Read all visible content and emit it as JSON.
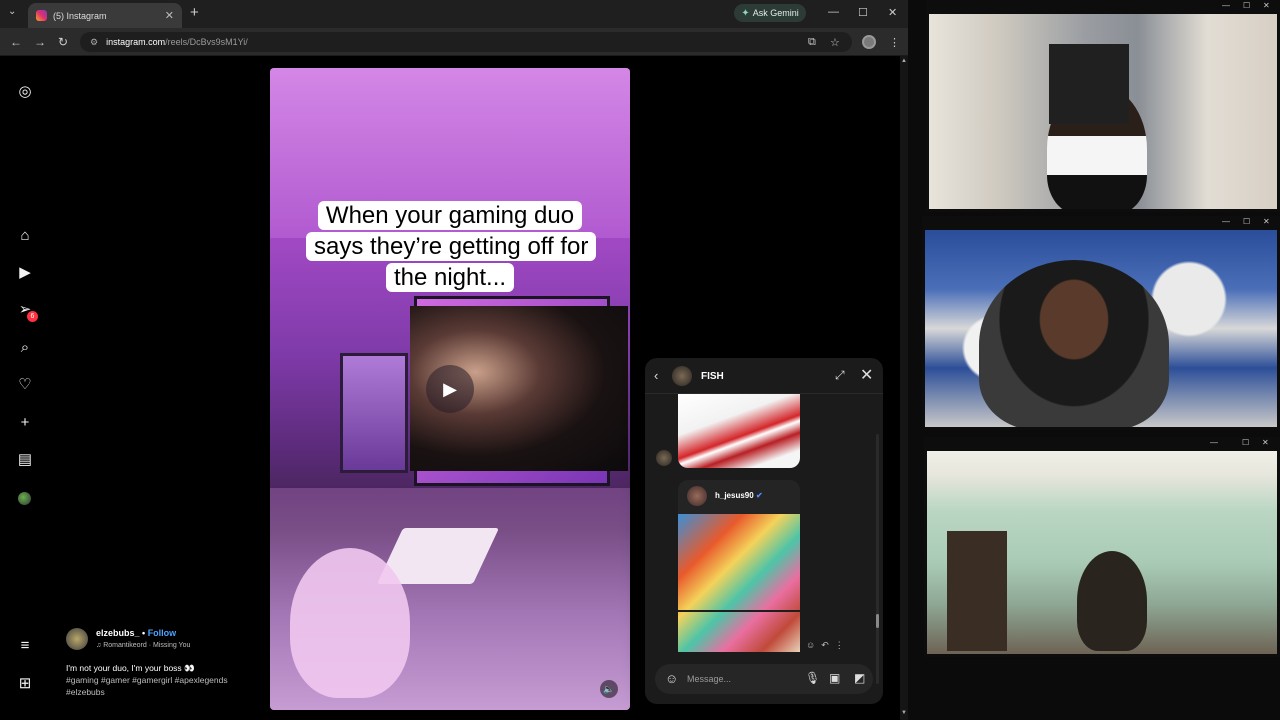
{
  "browser": {
    "tab_title": "(5) Instagram",
    "gemini_label": "Ask Gemini",
    "url_host": "instagram.com",
    "url_path": "/reels/DcBvs9sM1Yi/"
  },
  "sidebar": {
    "items": [
      {
        "icon": "instagram-logo-icon",
        "label": "Instagram"
      },
      {
        "icon": "home-icon",
        "label": "Home"
      },
      {
        "icon": "reels-icon",
        "label": "Reels"
      },
      {
        "icon": "messages-icon",
        "label": "Messages",
        "badge": "6"
      },
      {
        "icon": "search-icon",
        "label": "Search"
      },
      {
        "icon": "heart-icon",
        "label": "Notifications"
      },
      {
        "icon": "create-icon",
        "label": "Create"
      },
      {
        "icon": "dashboard-icon",
        "label": "Dashboard"
      },
      {
        "icon": "profile-avatar-icon",
        "label": "Profile"
      },
      {
        "icon": "menu-icon",
        "label": "More"
      },
      {
        "icon": "apps-icon",
        "label": "Also from Meta"
      }
    ]
  },
  "reel": {
    "caption": "When your gaming duo says they’re getting off for the night...",
    "username": "elzebubs_",
    "follow_label": "Follow",
    "music": "Romantikeord · Missing You",
    "description": "I'm not your duo, I'm your boss 👀",
    "hashtags": "#gaming #gamer #gamergirl #apexlegends #elzebubs"
  },
  "dm": {
    "chat_name": "FISH",
    "shared_user": "h_jesus90",
    "composer_placeholder": "Message..."
  },
  "colors": {
    "accent_link": "#4da3ff",
    "badge": "#ff3040",
    "panel": "#1b1b1c"
  }
}
